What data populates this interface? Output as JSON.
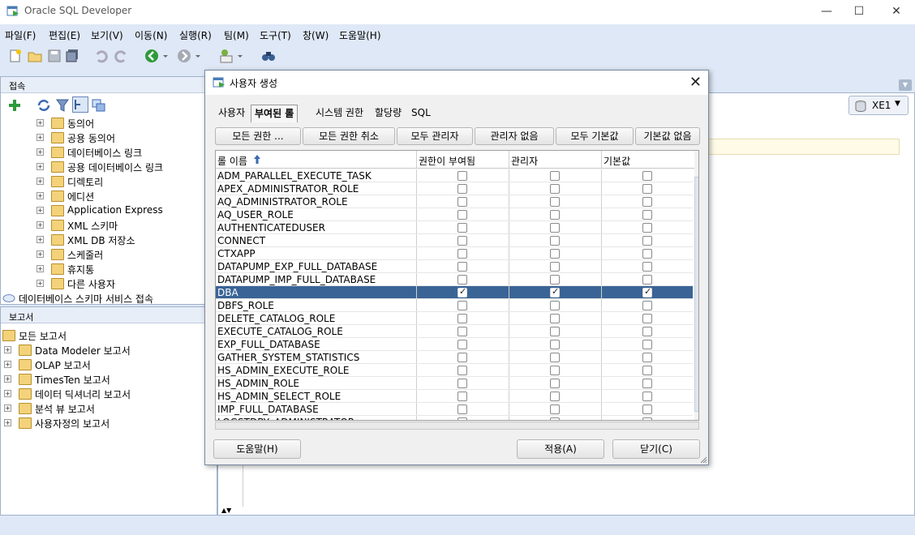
{
  "window": {
    "title": "Oracle SQL Developer",
    "minimize": "—",
    "maximize": "☐",
    "close": "✕"
  },
  "menu": [
    "파일(F)",
    "편집(E)",
    "보기(V)",
    "이동(N)",
    "실행(R)",
    "팀(M)",
    "도구(T)",
    "창(W)",
    "도움말(H)"
  ],
  "connections": {
    "header": "접속",
    "items": [
      "동의어",
      "공용 동의어",
      "데이터베이스 링크",
      "공용 데이터베이스 링크",
      "디렉토리",
      "에디션",
      "Application Express",
      "XML 스키마",
      "XML DB 저장소",
      "스케줄러",
      "휴지통",
      "다른 사용자"
    ],
    "bottom_item": "데이터베이스 스키마 서비스 접속"
  },
  "reports": {
    "header": "보고서",
    "root": "모든 보고서",
    "items": [
      "Data Modeler 보고서",
      "OLAP 보고서",
      "TimesTen 보고서",
      "데이터 딕셔너리 보고서",
      "분석 뷰 보고서",
      "사용자정의 보고서"
    ]
  },
  "connection_selector": "XE1",
  "dialog": {
    "title": "사용자 생성",
    "close": "✕",
    "tabs": [
      "사용자",
      "부여된 롤",
      "시스템 권한",
      "할당량",
      "SQL"
    ],
    "active_tab": "부여된 롤",
    "action_buttons": [
      "모든 권한 ...",
      "모든 권한 취소",
      "모두 관리자",
      "관리자 없음",
      "모두 기본값",
      "기본값 없음"
    ],
    "columns": [
      "롤 이름",
      "권한이 부여됨",
      "관리자",
      "기본값"
    ],
    "rows": [
      {
        "name": "ADM_PARALLEL_EXECUTE_TASK",
        "granted": false,
        "admin": false,
        "default": false
      },
      {
        "name": "APEX_ADMINISTRATOR_ROLE",
        "granted": false,
        "admin": false,
        "default": false
      },
      {
        "name": "AQ_ADMINISTRATOR_ROLE",
        "granted": false,
        "admin": false,
        "default": false
      },
      {
        "name": "AQ_USER_ROLE",
        "granted": false,
        "admin": false,
        "default": false
      },
      {
        "name": "AUTHENTICATEDUSER",
        "granted": false,
        "admin": false,
        "default": false
      },
      {
        "name": "CONNECT",
        "granted": false,
        "admin": false,
        "default": false
      },
      {
        "name": "CTXAPP",
        "granted": false,
        "admin": false,
        "default": false
      },
      {
        "name": "DATAPUMP_EXP_FULL_DATABASE",
        "granted": false,
        "admin": false,
        "default": false
      },
      {
        "name": "DATAPUMP_IMP_FULL_DATABASE",
        "granted": false,
        "admin": false,
        "default": false
      },
      {
        "name": "DBA",
        "granted": true,
        "admin": true,
        "default": true,
        "selected": true
      },
      {
        "name": "DBFS_ROLE",
        "granted": false,
        "admin": false,
        "default": false
      },
      {
        "name": "DELETE_CATALOG_ROLE",
        "granted": false,
        "admin": false,
        "default": false
      },
      {
        "name": "EXECUTE_CATALOG_ROLE",
        "granted": false,
        "admin": false,
        "default": false
      },
      {
        "name": "EXP_FULL_DATABASE",
        "granted": false,
        "admin": false,
        "default": false
      },
      {
        "name": "GATHER_SYSTEM_STATISTICS",
        "granted": false,
        "admin": false,
        "default": false
      },
      {
        "name": "HS_ADMIN_EXECUTE_ROLE",
        "granted": false,
        "admin": false,
        "default": false
      },
      {
        "name": "HS_ADMIN_ROLE",
        "granted": false,
        "admin": false,
        "default": false
      },
      {
        "name": "HS_ADMIN_SELECT_ROLE",
        "granted": false,
        "admin": false,
        "default": false
      },
      {
        "name": "IMP_FULL_DATABASE",
        "granted": false,
        "admin": false,
        "default": false
      },
      {
        "name": "LOGSTDBY_ADMINISTRATOR",
        "granted": false,
        "admin": false,
        "default": false
      }
    ],
    "help_button": "도움말(H)",
    "apply_button": "적용(A)",
    "close_button": "닫기(C)"
  },
  "colors": {
    "selection": "#3a6496",
    "chrome": "#dfe8f6"
  }
}
